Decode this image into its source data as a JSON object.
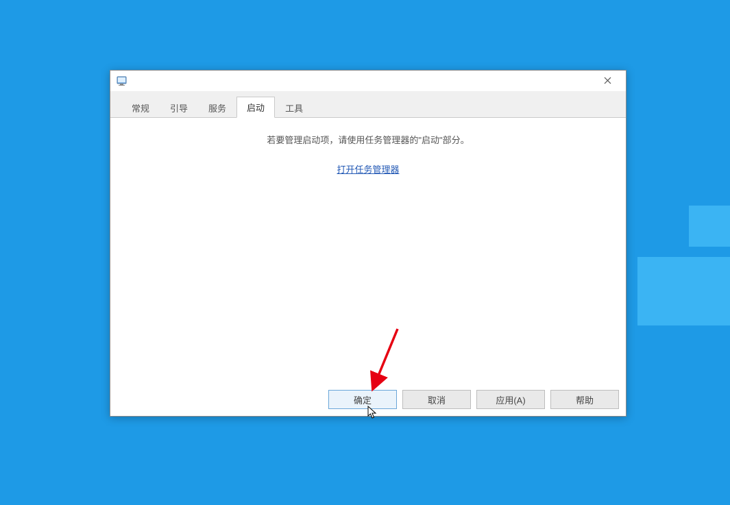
{
  "window": {
    "title": "",
    "tabs": [
      {
        "label": "常规",
        "active": false
      },
      {
        "label": "引导",
        "active": false
      },
      {
        "label": "服务",
        "active": false
      },
      {
        "label": "启动",
        "active": true
      },
      {
        "label": "工具",
        "active": false
      }
    ],
    "content": {
      "info_text": "若要管理启动项，请使用任务管理器的\"启动\"部分。",
      "link_text": "打开任务管理器"
    },
    "buttons": {
      "ok": "确定",
      "cancel": "取消",
      "apply": "应用(A)",
      "help": "帮助"
    }
  },
  "annotation": {
    "arrow_color": "#e60012"
  }
}
